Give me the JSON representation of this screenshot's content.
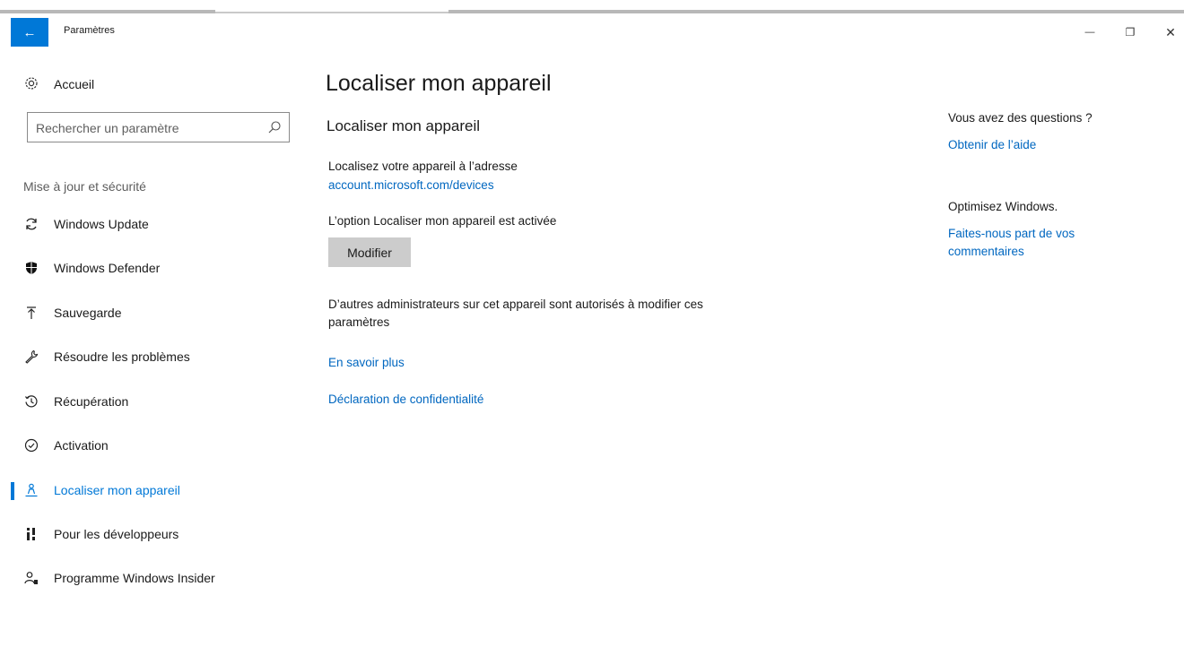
{
  "window": {
    "title": "Paramètres",
    "back_glyph": "←",
    "minimize_glyph": "—",
    "maximize_glyph": "❐",
    "close_glyph": "✕",
    "accent_color": "#0078d7"
  },
  "sidebar": {
    "home_label": "Accueil",
    "search_placeholder": "Rechercher un paramètre",
    "section_label": "Mise à jour et sécurité",
    "items": [
      {
        "label": "Windows Update",
        "icon": "sync-icon"
      },
      {
        "label": "Windows Defender",
        "icon": "shield-icon"
      },
      {
        "label": "Sauvegarde",
        "icon": "upload-icon"
      },
      {
        "label": "Résoudre les problèmes",
        "icon": "wrench-icon"
      },
      {
        "label": "Récupération",
        "icon": "history-icon"
      },
      {
        "label": "Activation",
        "icon": "check-circle-icon"
      },
      {
        "label": "Localiser mon appareil",
        "icon": "person-location-icon",
        "active": true
      },
      {
        "label": "Pour les développeurs",
        "icon": "developer-tools-icon"
      },
      {
        "label": "Programme Windows Insider",
        "icon": "insider-icon"
      }
    ]
  },
  "main": {
    "page_title": "Localiser mon appareil",
    "section_title": "Localiser mon appareil",
    "locate_text": "Localisez votre appareil à l’adresse",
    "locate_link": "account.microsoft.com/devices",
    "status_text": "L’option Localiser mon appareil est activée",
    "modify_button": "Modifier",
    "admins_text": "D’autres administrateurs sur cet appareil sont autorisés à modifier ces paramètres",
    "learn_more_link": "En savoir plus",
    "privacy_link": "Déclaration de confidentialité"
  },
  "aside": {
    "questions_heading": "Vous avez des questions ?",
    "help_link": "Obtenir de l’aide",
    "improve_heading": "Optimisez Windows.",
    "feedback_link": "Faites-nous part de vos commentaires"
  }
}
